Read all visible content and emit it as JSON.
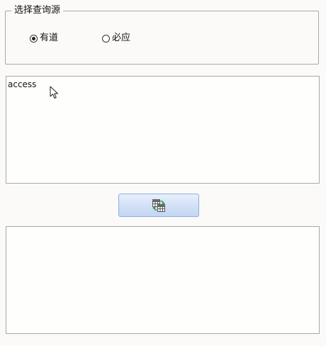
{
  "source_group": {
    "title": "选择查询源",
    "options": [
      {
        "label": "有道",
        "checked": true
      },
      {
        "label": "必应",
        "checked": false
      }
    ]
  },
  "input": {
    "value": "access"
  },
  "output": {
    "value": ""
  },
  "query_button": {
    "icon": "translate-table-icon"
  }
}
